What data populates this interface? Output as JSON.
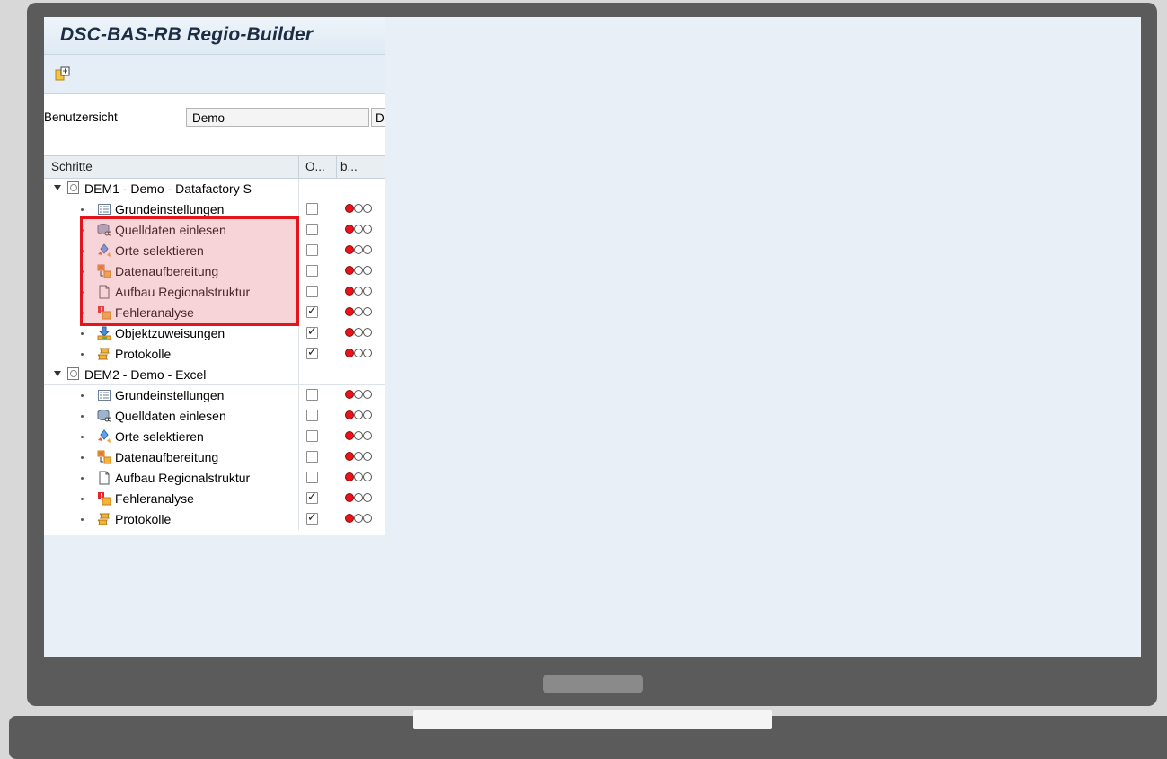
{
  "app": {
    "title": "DSC-BAS-RB Regio-Builder",
    "toolbar": {
      "icon": "display-change-icon"
    },
    "view": {
      "label": "Benutzersicht",
      "value": "Demo",
      "value2": "D"
    }
  },
  "tree": {
    "headers": {
      "steps": "Schritte",
      "col_o": "O...",
      "col_b": "b..."
    },
    "groups": [
      {
        "title": "DEM1 - Demo - Datafactory S",
        "steps": [
          {
            "label": "Grundeinstellungen",
            "icon": "settings-list-icon",
            "checked": false,
            "status": "red"
          },
          {
            "label": "Quelldaten einlesen",
            "icon": "database-read-icon",
            "checked": false,
            "status": "red"
          },
          {
            "label": "Orte selektieren",
            "icon": "selection-icon",
            "checked": false,
            "status": "red"
          },
          {
            "label": "Datenaufbereitung",
            "icon": "data-prep-icon",
            "checked": false,
            "status": "red"
          },
          {
            "label": "Aufbau Regionalstruktur",
            "icon": "document-icon",
            "checked": false,
            "status": "red"
          },
          {
            "label": "Fehleranalyse",
            "icon": "error-analysis-icon",
            "checked": true,
            "status": "red"
          },
          {
            "label": "Objektzuweisungen",
            "icon": "assignment-icon",
            "checked": true,
            "status": "red"
          },
          {
            "label": "Protokolle",
            "icon": "log-icon",
            "checked": true,
            "status": "red"
          }
        ]
      },
      {
        "title": "DEM2 - Demo - Excel",
        "steps": [
          {
            "label": "Grundeinstellungen",
            "icon": "settings-list-icon",
            "checked": false,
            "status": "red"
          },
          {
            "label": "Quelldaten einlesen",
            "icon": "database-read-icon",
            "checked": false,
            "status": "red"
          },
          {
            "label": "Orte selektieren",
            "icon": "selection-icon",
            "checked": false,
            "status": "red"
          },
          {
            "label": "Datenaufbereitung",
            "icon": "data-prep-icon",
            "checked": false,
            "status": "red"
          },
          {
            "label": "Aufbau Regionalstruktur",
            "icon": "document-icon",
            "checked": false,
            "status": "red"
          },
          {
            "label": "Fehleranalyse",
            "icon": "error-analysis-icon",
            "checked": true,
            "status": "red"
          },
          {
            "label": "Protokolle",
            "icon": "log-icon",
            "checked": true,
            "status": "red"
          }
        ]
      }
    ]
  },
  "colors": {
    "highlight": "#e2141c",
    "status_red": "#e8141a",
    "frame": "#5b5b5b"
  }
}
